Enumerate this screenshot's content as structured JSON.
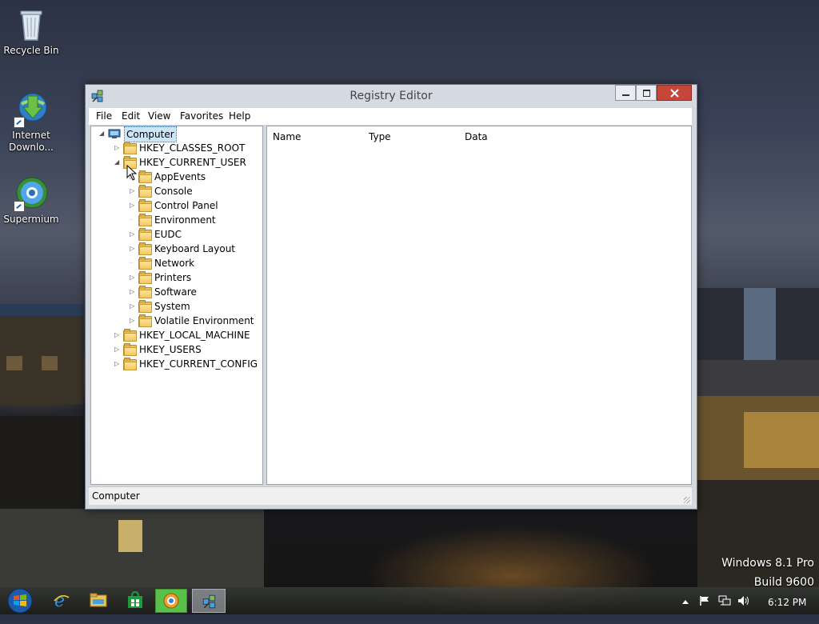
{
  "desktop": {
    "icons": [
      {
        "label": "Recycle Bin"
      },
      {
        "label": "Internet Downlo..."
      },
      {
        "label": "Supermium"
      }
    ],
    "watermark": {
      "line1": "Windows 8.1 Pro",
      "line2": "Build 9600"
    }
  },
  "window": {
    "title": "Registry Editor",
    "menu": [
      "File",
      "Edit",
      "View",
      "Favorites",
      "Help"
    ],
    "tree": {
      "root": "Computer",
      "hives": [
        {
          "label": "HKEY_CLASSES_ROOT"
        },
        {
          "label": "HKEY_CURRENT_USER",
          "children": [
            "AppEvents",
            "Console",
            "Control Panel",
            "Environment",
            "EUDC",
            "Keyboard Layout",
            "Network",
            "Printers",
            "Software",
            "System",
            "Volatile Environment"
          ]
        },
        {
          "label": "HKEY_LOCAL_MACHINE"
        },
        {
          "label": "HKEY_USERS"
        },
        {
          "label": "HKEY_CURRENT_CONFIG"
        }
      ]
    },
    "list_columns": [
      "Name",
      "Type",
      "Data"
    ],
    "status": "Computer"
  },
  "taskbar": {
    "clock": "6:12 PM"
  },
  "colors": {
    "close_button": "#c7463a",
    "selection": "#cde6f7",
    "folder": "#f3c95f"
  }
}
